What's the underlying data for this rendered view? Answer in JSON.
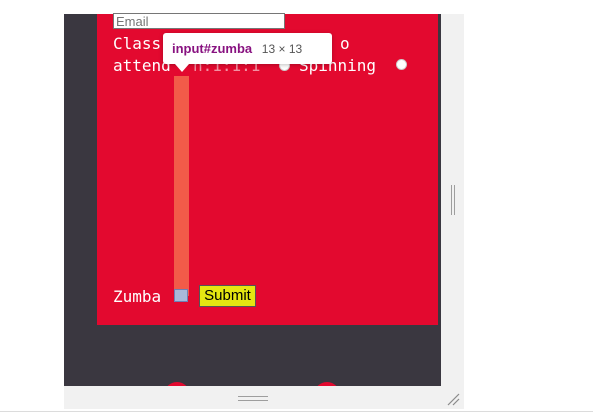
{
  "form": {
    "email_placeholder": "Email",
    "classes_line1": "Class",
    "classes_line1_tail": "o",
    "classes_line2": "attend",
    "classes_line2_mid": "n:1:1:1",
    "spinning_label": "Spinning",
    "zumba_label": "Zumba",
    "submit_label": "Submit"
  },
  "tooltip": {
    "selector": "input#zumba",
    "size": "13 × 13"
  },
  "colors": {
    "frame": "#3a3740",
    "form_background": "#e3092f",
    "highlight": "#f46a4e",
    "submit_background": "#e5e612",
    "tooltip_selector": "#881280"
  }
}
